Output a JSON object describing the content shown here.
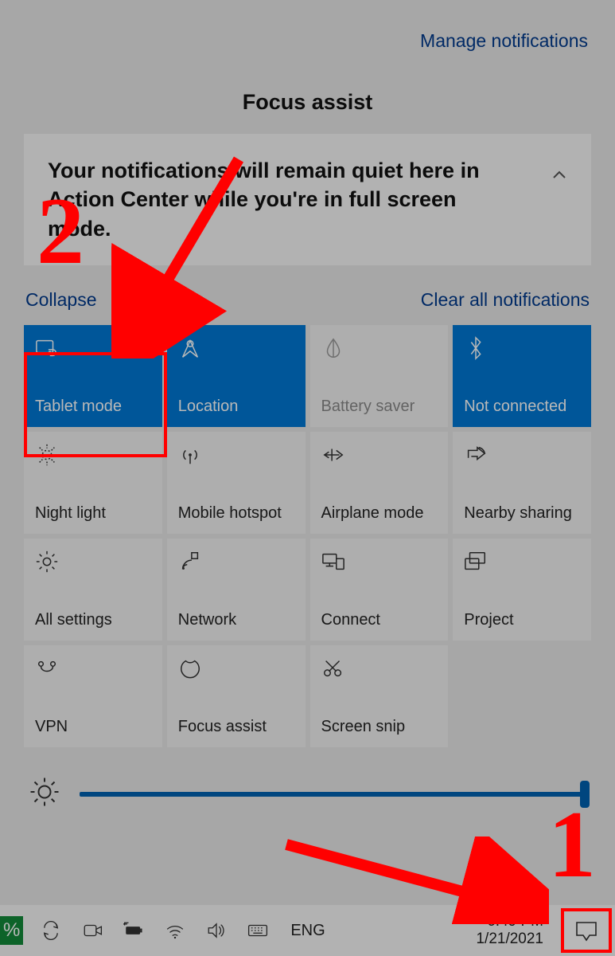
{
  "header": {
    "manage_link": "Manage notifications",
    "section_title": "Focus assist"
  },
  "notification": {
    "message": "Your notifications will remain quiet here in Action Center while you're in full screen mode."
  },
  "actions": {
    "collapse": "Collapse",
    "clear_all": "Clear all notifications"
  },
  "tiles": [
    {
      "label": "Tablet mode",
      "active": true,
      "icon": "tablet-mode-icon"
    },
    {
      "label": "Location",
      "active": true,
      "icon": "location-icon"
    },
    {
      "label": "Battery saver",
      "active": false,
      "icon": "battery-saver-icon",
      "dim": true
    },
    {
      "label": "Not connected",
      "active": true,
      "icon": "bluetooth-icon"
    },
    {
      "label": "Night light",
      "active": false,
      "icon": "night-light-icon"
    },
    {
      "label": "Mobile hotspot",
      "active": false,
      "icon": "hotspot-icon"
    },
    {
      "label": "Airplane mode",
      "active": false,
      "icon": "airplane-icon"
    },
    {
      "label": "Nearby sharing",
      "active": false,
      "icon": "nearby-sharing-icon"
    },
    {
      "label": "All settings",
      "active": false,
      "icon": "settings-icon"
    },
    {
      "label": "Network",
      "active": false,
      "icon": "network-icon"
    },
    {
      "label": "Connect",
      "active": false,
      "icon": "connect-icon"
    },
    {
      "label": "Project",
      "active": false,
      "icon": "project-icon"
    },
    {
      "label": "VPN",
      "active": false,
      "icon": "vpn-icon"
    },
    {
      "label": "Focus assist",
      "active": false,
      "icon": "focus-assist-icon"
    },
    {
      "label": "Screen snip",
      "active": false,
      "icon": "screen-snip-icon"
    }
  ],
  "brightness": {
    "value_percent": 100
  },
  "taskbar": {
    "battery_percent": "%",
    "language": "ENG",
    "time": "6:49 PM",
    "date": "1/21/2021"
  },
  "annotations": {
    "step1": "1",
    "step2": "2"
  }
}
